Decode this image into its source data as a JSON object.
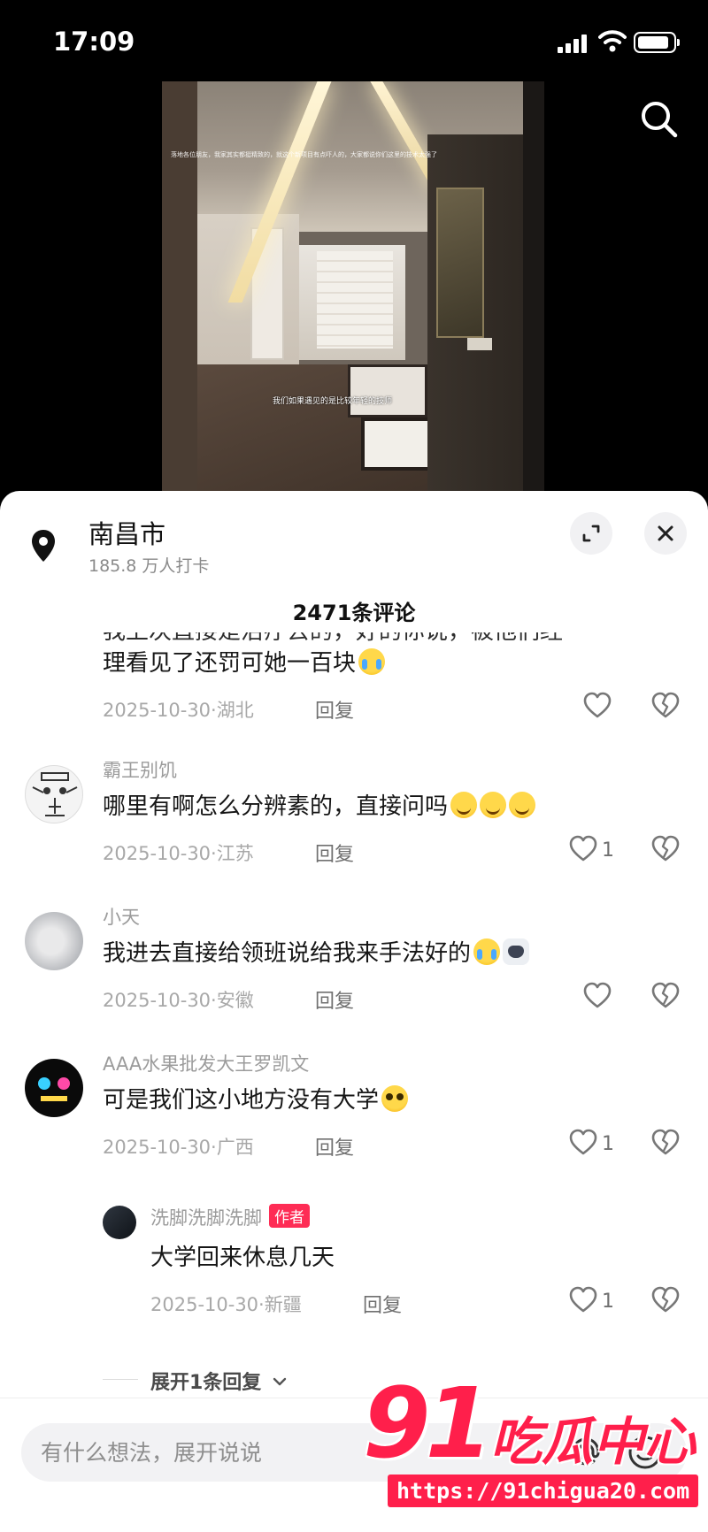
{
  "status_bar": {
    "time": "17:09",
    "battery_percent": 90
  },
  "video": {
    "caption_top": "落地各位朋友，我家其实都挺精致的，就这个新项目有点吓人的，大家都说你们这里的技术太强了",
    "caption_mid": "我们如果遇见的是比较年轻的技师"
  },
  "location": {
    "name": "南昌市",
    "checkins": "185.8 万人打卡"
  },
  "comment_count": "2471条评论",
  "comments": [
    {
      "partial_top": "我上次直接是治疗去的，好的你说，被他们经",
      "text": "理看见了还罚可她一百块",
      "emojis": [
        "cry"
      ],
      "date": "2025-10-30",
      "region": "湖北",
      "reply": "回复",
      "likes": ""
    },
    {
      "name": "霸王别饥",
      "text": "哪里有啊怎么分辨素的，直接问吗",
      "emojis": [
        "smile",
        "smile",
        "smile"
      ],
      "date": "2025-10-30",
      "region": "江苏",
      "reply": "回复",
      "likes": "1"
    },
    {
      "name": "小天",
      "text": "我进去直接给领班说给我来手法好的",
      "emojis": [
        "cry",
        "cat"
      ],
      "date": "2025-10-30",
      "region": "安徽",
      "reply": "回复",
      "likes": ""
    },
    {
      "name": "AAA水果批发大王罗凯文",
      "text": "可是我们这小地方没有大学",
      "emojis": [
        "plead"
      ],
      "date": "2025-10-30",
      "region": "广西",
      "reply": "回复",
      "likes": "1"
    },
    {
      "name": "洗脚洗脚洗脚",
      "badge": "作者",
      "text": "大学回来休息几天",
      "emojis": [],
      "date": "2025-10-30",
      "region": "新疆",
      "reply": "回复",
      "likes": "1"
    }
  ],
  "expand_more": "展开1条回复",
  "input": {
    "placeholder": "有什么想法，展开说说"
  },
  "watermark": {
    "num": "91",
    "cn": "吃瓜中心",
    "url": "https://91chigua20.com"
  },
  "colors": {
    "accent": "#fe2c55",
    "watermark": "#ff1f4b"
  }
}
